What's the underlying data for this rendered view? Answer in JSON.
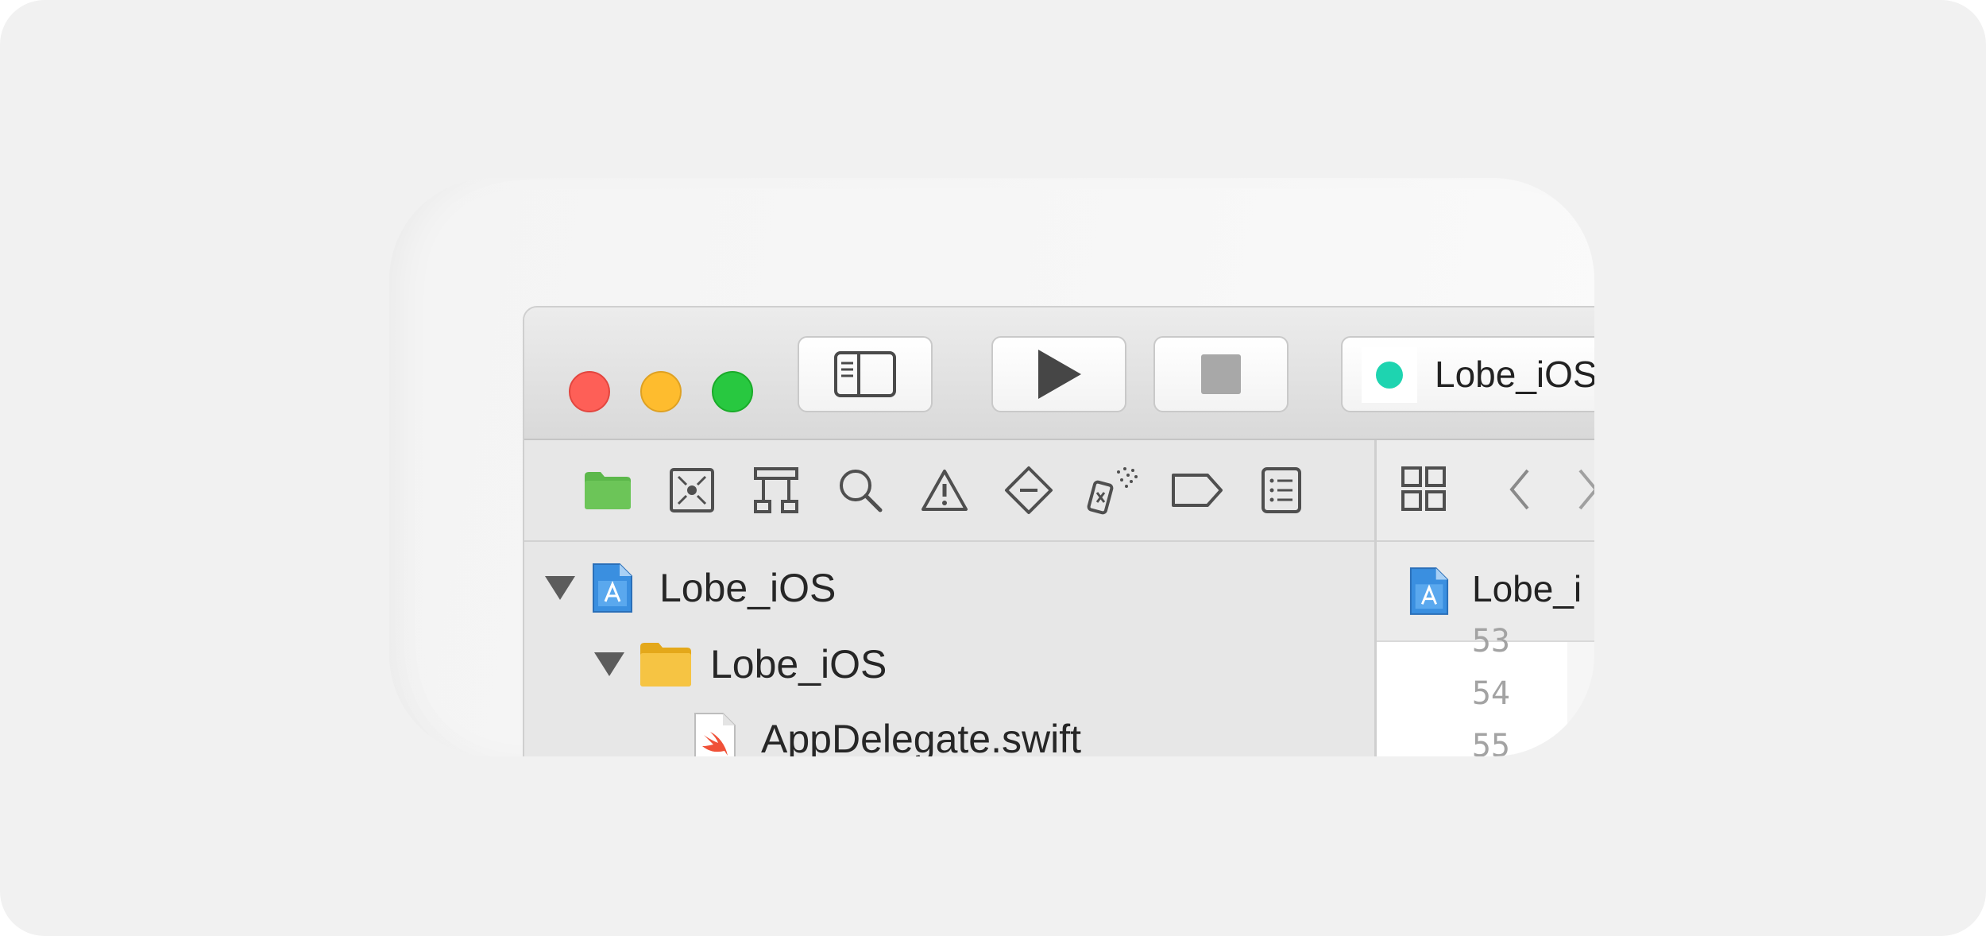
{
  "toolbar": {
    "window_controls": {
      "close": {
        "icon": "close-light",
        "color": "#fe5f57"
      },
      "minimize": {
        "icon": "minimize-light",
        "color": "#febc2e"
      },
      "zoom": {
        "icon": "zoom-light",
        "color": "#28c840"
      }
    },
    "buttons": [
      {
        "name": "toggle-navigator",
        "icon": "sidebar-icon"
      },
      {
        "name": "run",
        "icon": "play-icon"
      },
      {
        "name": "stop",
        "icon": "stop-icon"
      }
    ],
    "scheme": {
      "label": "Lobe_iOS",
      "status_color": "#1ed4b0"
    }
  },
  "navigator": {
    "tabs": [
      {
        "name": "project-navigator",
        "icon": "folder-icon",
        "selected": true
      },
      {
        "name": "source-control-navigator",
        "icon": "source-control-icon"
      },
      {
        "name": "symbol-navigator",
        "icon": "hierarchy-icon"
      },
      {
        "name": "find-navigator",
        "icon": "search-icon"
      },
      {
        "name": "issue-navigator",
        "icon": "warning-icon"
      },
      {
        "name": "test-navigator",
        "icon": "test-diamond-icon"
      },
      {
        "name": "debug-navigator",
        "icon": "spray-icon"
      },
      {
        "name": "breakpoint-navigator",
        "icon": "breakpoint-icon"
      },
      {
        "name": "report-navigator",
        "icon": "report-list-icon"
      }
    ],
    "tree": [
      {
        "label": "Lobe_iOS",
        "icon": "xcode-project-icon",
        "expanded": true,
        "depth": 0
      },
      {
        "label": "Lobe_iOS",
        "icon": "folder-icon",
        "expanded": true,
        "depth": 1
      },
      {
        "label": "AppDelegate.swift",
        "icon": "swift-file-icon",
        "depth": 2
      }
    ]
  },
  "editor": {
    "jump_bar": [
      {
        "name": "related-items",
        "icon": "grid-icon"
      },
      {
        "name": "go-back",
        "icon": "chevron-left-icon"
      },
      {
        "name": "go-forward",
        "icon": "chevron-right-icon"
      }
    ],
    "tab": {
      "label": "Lobe_i",
      "icon": "xcode-project-icon"
    },
    "line_numbers": [
      "53",
      "54",
      "55"
    ]
  }
}
